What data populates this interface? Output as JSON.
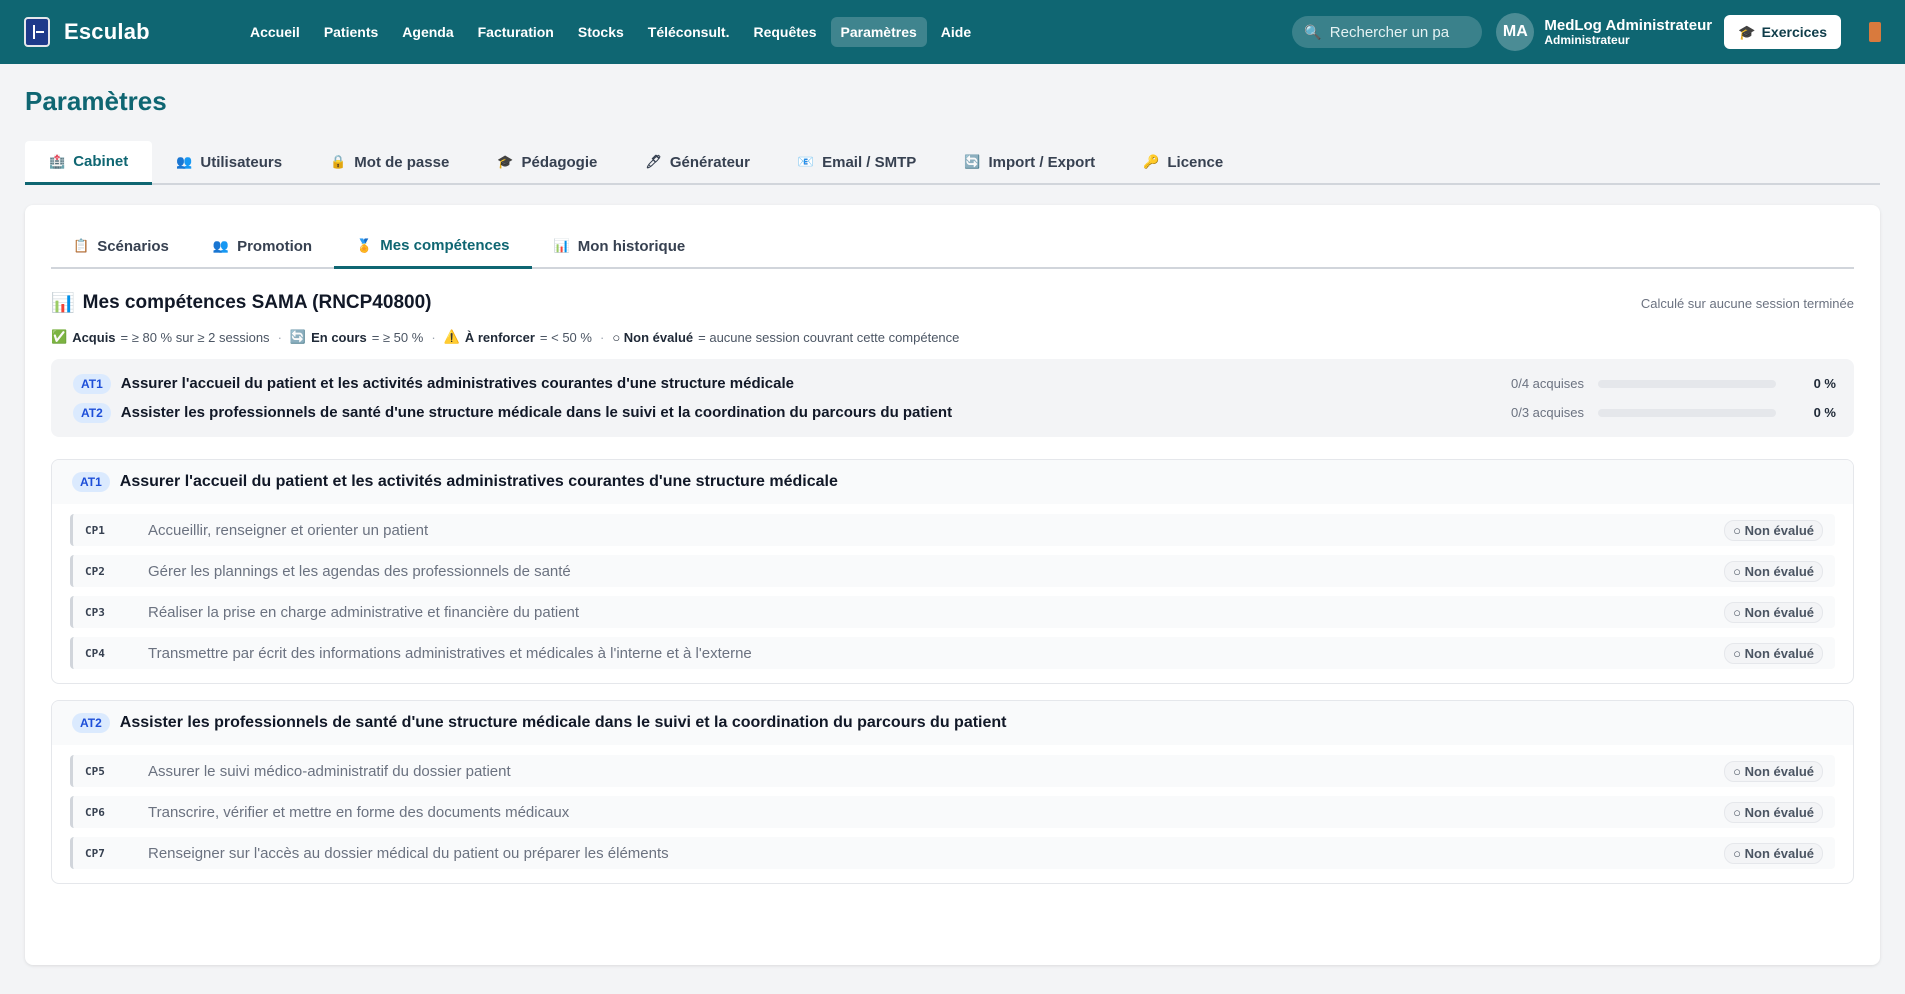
{
  "app": {
    "name": "Esculab",
    "nav": [
      "Accueil",
      "Patients",
      "Agenda",
      "Facturation",
      "Stocks",
      "Téléconsult.",
      "Requêtes",
      "Paramètres",
      "Aide"
    ],
    "search_placeholder": "Rechercher un pa",
    "user_initials": "MA",
    "user_name": "MedLog Administrateur",
    "user_role": "Administrateur",
    "exercices_label": "Exercices"
  },
  "page": {
    "title": "Paramètres",
    "tabs": [
      "Cabinet",
      "Utilisateurs",
      "Mot de passe",
      "Pédagogie",
      "Générateur",
      "Email / SMTP",
      "Import / Export",
      "Licence"
    ],
    "active_tab": "Cabinet"
  },
  "subtabs": [
    "Scénarios",
    "Promotion",
    "Mes compétences",
    "Mon historique"
  ],
  "competences": {
    "title": "Mes compétences SAMA (RNCP40800)",
    "note": "Calculé sur aucune session terminée",
    "legend": {
      "acquis": "Acquis",
      "acquis_desc": "= ≥ 80 % sur ≥ 2 sessions",
      "encours": "En cours",
      "encours_desc": "= ≥ 50 %",
      "renforcer": "À renforcer",
      "renforcer_desc": "= < 50 %",
      "nonevalue": "○ Non évalué",
      "nonevalue_desc": "= aucune session couvrant cette compétence"
    },
    "summary": [
      {
        "code": "AT1",
        "label": "Assurer l'accueil du patient et les activités administratives courantes d'une structure médicale",
        "count": "0/4 acquises",
        "pct": "0 %",
        "value": 0
      },
      {
        "code": "AT2",
        "label": "Assister les professionnels de santé d'une structure médicale dans le suivi et la coordination du parcours du patient",
        "count": "0/3 acquises",
        "pct": "0 %",
        "value": 0
      }
    ],
    "groups": [
      {
        "code": "AT1",
        "title": "Assurer l'accueil du patient et les activités administratives courantes d'une structure médicale",
        "items": [
          {
            "code": "CP1",
            "label": "Accueillir, renseigner et orienter un patient",
            "status": "○ Non évalué"
          },
          {
            "code": "CP2",
            "label": "Gérer les plannings et les agendas des professionnels de santé",
            "status": "○ Non évalué"
          },
          {
            "code": "CP3",
            "label": "Réaliser la prise en charge administrative et financière du patient",
            "status": "○ Non évalué"
          },
          {
            "code": "CP4",
            "label": "Transmettre par écrit des informations administratives et médicales à l'interne et à l'externe",
            "status": "○ Non évalué"
          }
        ]
      },
      {
        "code": "AT2",
        "title": "Assister les professionnels de santé d'une structure médicale dans le suivi et la coordination du parcours du patient",
        "items": [
          {
            "code": "CP5",
            "label": "Assurer le suivi médico-administratif du dossier patient",
            "status": "○ Non évalué"
          },
          {
            "code": "CP6",
            "label": "Transcrire, vérifier et mettre en forme des documents médicaux",
            "status": "○ Non évalué"
          },
          {
            "code": "CP7",
            "label": "Renseigner sur l'accès au dossier médical du patient ou préparer les éléments",
            "status": "○ Non évalué"
          }
        ]
      }
    ]
  }
}
